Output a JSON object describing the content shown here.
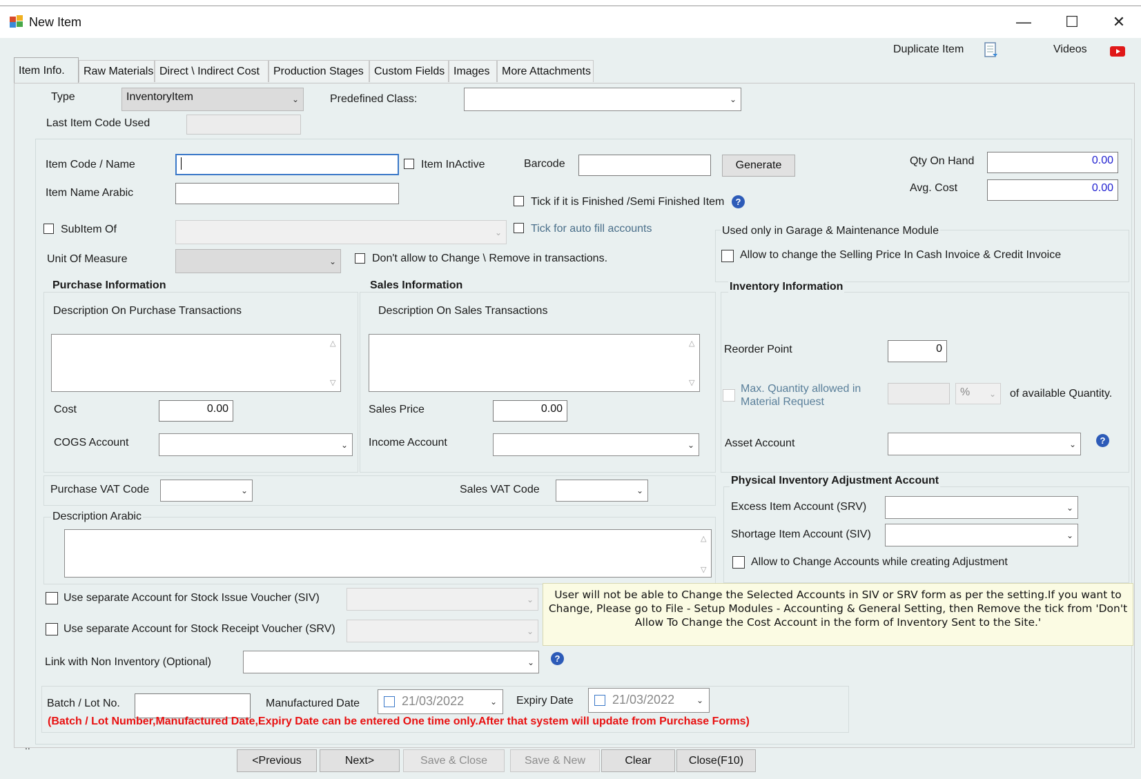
{
  "window": {
    "title": "New Item",
    "minimize": "—",
    "maximize": "☐",
    "close": "✕"
  },
  "top_links": {
    "duplicate_item": "Duplicate Item",
    "videos": "Videos"
  },
  "tabs": [
    {
      "label": "Item Info.",
      "active": true
    },
    {
      "label": "Raw Materials"
    },
    {
      "label": "Direct \\ Indirect Cost"
    },
    {
      "label": "Production Stages"
    },
    {
      "label": "Custom Fields"
    },
    {
      "label": "Images"
    },
    {
      "label": "More Attachments"
    }
  ],
  "header": {
    "type_label": "Type",
    "type_value": "InventoryItem",
    "predefined_class_label": "Predefined Class:",
    "predefined_class_value": "",
    "last_item_code_label": "Last Item Code Used",
    "last_item_code_value": ""
  },
  "item": {
    "code_name_label": "Item Code / Name",
    "code_name_value": "",
    "inactive_label": "Item InActive",
    "barcode_label": "Barcode",
    "barcode_value": "",
    "generate_button": "Generate",
    "qty_on_hand_label": "Qty On Hand",
    "qty_on_hand_value": "0.00",
    "avg_cost_label": "Avg. Cost",
    "avg_cost_value": "0.00",
    "name_arabic_label": "Item Name Arabic",
    "name_arabic_value": "",
    "finished_label": "Tick if it is Finished /Semi Finished Item",
    "subitem_label": "SubItem Of",
    "autofill_label": "Tick for auto fill accounts",
    "uom_label": "Unit Of Measure",
    "dont_allow_label": "Don't allow to Change \\ Remove in transactions."
  },
  "garage": {
    "legend": "Used only in Garage & Maintenance Module",
    "allow_price_label": "Allow to change the Selling Price In Cash Invoice & Credit Invoice"
  },
  "purchase": {
    "title": "Purchase Information",
    "desc_label": "Description On  Purchase Transactions",
    "cost_label": "Cost",
    "cost_value": "0.00",
    "cogs_label": "COGS Account",
    "vat_label": "Purchase VAT Code"
  },
  "sales": {
    "title": "Sales Information",
    "desc_label": "Description On Sales Transactions",
    "price_label": "Sales Price",
    "price_value": "0.00",
    "income_label": "Income Account",
    "vat_label": "Sales VAT Code"
  },
  "inventory": {
    "title": "Inventory Information",
    "reorder_label": "Reorder Point",
    "reorder_value": "0",
    "max_qty_label_1": "Max. Quantity allowed in",
    "max_qty_label_2": "Material Request",
    "percent": "%",
    "of_available": "of available Quantity.",
    "asset_label": "Asset Account"
  },
  "adjustment": {
    "title": "Physical Inventory Adjustment Account",
    "excess_label": "Excess Item Account (SRV)",
    "shortage_label": "Shortage Item Account (SIV)",
    "allow_change_label": "Allow to Change Accounts while creating Adjustment"
  },
  "description_arabic_label": "Description Arabic",
  "siv_label": "Use separate Account for Stock Issue Voucher (SIV)",
  "srv_label": "Use separate Account for Stock Receipt Voucher (SRV)",
  "note_text": "User will not be able to Change the Selected Accounts in SIV or SRV form as per the setting.If you want to Change, Please go to File - Setup Modules - Accounting & General Setting, then Remove the tick from 'Don't Allow To Change the Cost Account in the form of Inventory Sent to the Site.'",
  "link_non_inventory_label": "Link with Non Inventory (Optional)",
  "batch": {
    "batch_label": "Batch / Lot No.",
    "manufactured_label": "Manufactured Date",
    "manufactured_value": "21/03/2022",
    "expiry_label": "Expiry Date",
    "expiry_value": "21/03/2022",
    "warning": "(Batch / Lot Number,Manufactured Date,Expiry Date can be entered One time only.After that system will update from Purchase Forms)"
  },
  "footer": {
    "dots": "..",
    "previous": "<Previous",
    "next": "Next>",
    "save_close": "Save & Close",
    "save_new": "Save & New",
    "clear": "Clear",
    "close": "Close(F10)"
  },
  "colors": {
    "panel_bg": "#e9f0f0",
    "warning_red": "#e81010",
    "help_blue": "#2d5bb8",
    "note_bg": "#fbfbe3",
    "youtube_red": "#e01818"
  }
}
